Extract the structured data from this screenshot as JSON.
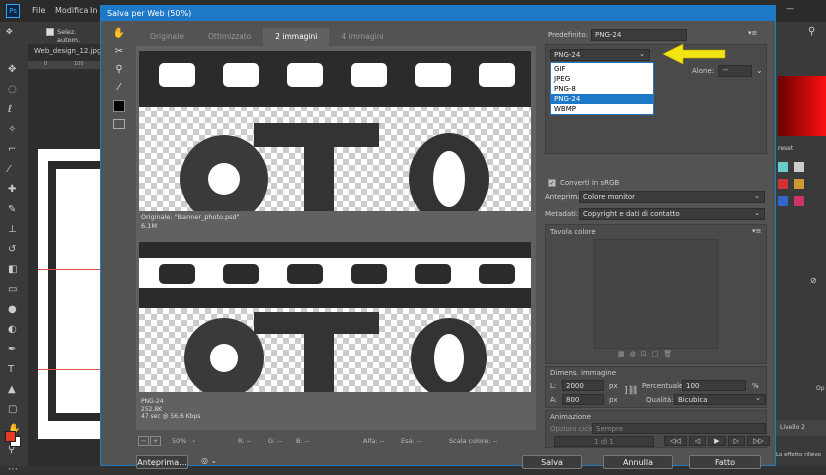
{
  "ps_menu": {
    "file": "File",
    "modifica": "Modifica",
    "im": "In"
  },
  "ps_options": {
    "auto_select": "Selez. autom."
  },
  "ps_doc_tab": "Web_design_12.jpg",
  "ps_ruler": {
    "r0": "0",
    "r100": "100"
  },
  "dialog": {
    "title": "Salva per Web (50%)",
    "tabs": [
      "Originale",
      "Ottimizzato",
      "2 immagini",
      "4 immagini"
    ],
    "active_tab": "2 immagini",
    "preview_top": {
      "name": "Originale: \"Banner_photo.psd\"",
      "size": "6,1M"
    },
    "preview_bottom": {
      "format": "PNG-24",
      "size": "252,8K",
      "time": "47 sec @ 56,6 Kbps"
    },
    "status_bar": {
      "zoom": "50%",
      "r": "R: --",
      "g": "G: --",
      "b": "B: --",
      "alpha": "Alfa: --",
      "hex": "Esa: --",
      "color_index": "Scala colore: --"
    },
    "buttons": {
      "preview": "Anteprima...",
      "save": "Salva",
      "cancel": "Annulla",
      "done": "Fatto"
    },
    "preset": {
      "label": "Predefinito:",
      "value": "PNG-24"
    },
    "format_dropdown": {
      "value": "PNG-24",
      "options": [
        "GIF",
        "JPEG",
        "PNG-8",
        "PNG-24",
        "WBMP"
      ],
      "selected": "PNG-24"
    },
    "matte": {
      "label": "Alone:",
      "value": "--"
    },
    "convert_srgb": "Converti in sRGB",
    "preview_opt": {
      "label": "Anteprima:",
      "value": "Colore monitor"
    },
    "metadata": {
      "label": "Metadati:",
      "value": "Copyright e dati di contatto"
    },
    "color_table": "Tavola colore",
    "image_size": {
      "title": "Dimens. immagine",
      "w_label": "L:",
      "w": "2000",
      "h_label": "A:",
      "h": "800",
      "unit": "px",
      "pct_label": "Percentuale:",
      "pct": "100",
      "pct_unit": "%",
      "quality_label": "Qualità:",
      "quality": "Bicubica"
    },
    "animation": {
      "title": "Animazione",
      "loop_label": "Opzioni ciclo:",
      "loop": "Sempre",
      "frame": "1 di 1"
    }
  },
  "right_panel": {
    "tab": "reset",
    "layer": "Livello 2",
    "hint": "Lo effetto rilievo",
    "op": "Op"
  },
  "colors": {
    "accent": "#1e78c8",
    "arrow": "#f2e313",
    "fg": "#e53a25"
  }
}
